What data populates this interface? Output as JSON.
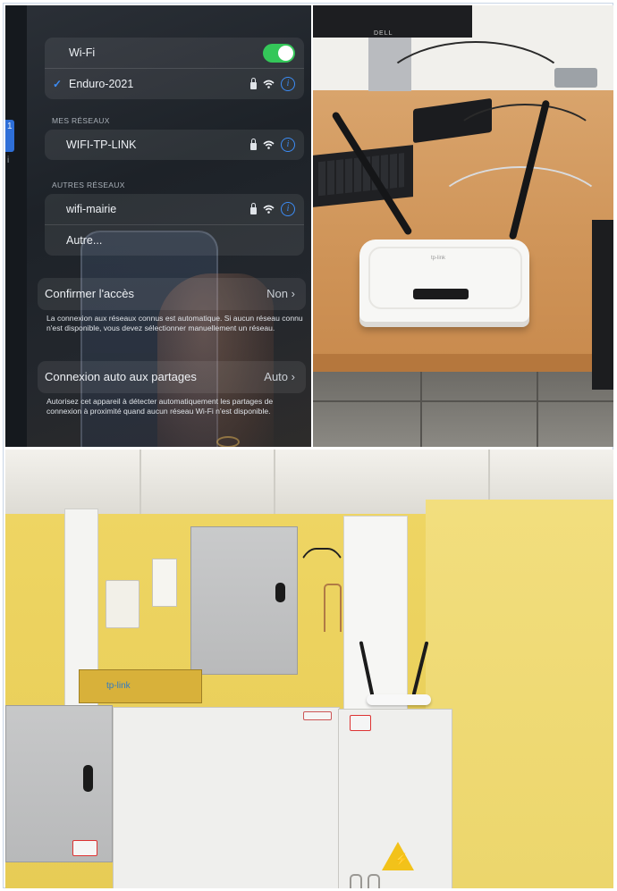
{
  "wifi_settings": {
    "wifi_label": "Wi-Fi",
    "wifi_enabled": true,
    "connected_network": "Enduro-2021",
    "my_networks_header": "MES RÉSEAUX",
    "my_networks": [
      "WIFI-TP-LINK"
    ],
    "other_networks_header": "AUTRES RÉSEAUX",
    "other_networks": [
      "wifi-mairie"
    ],
    "other_label": "Autre...",
    "ask_join": {
      "label": "Confirmer l'accès",
      "value": "Non",
      "help": "La connexion aux réseaux connus est automatique. Si aucun réseau connu n'est disponible, vous devez sélectionner manuellement un réseau."
    },
    "auto_hotspot": {
      "label": "Connexion auto aux partages",
      "value": "Auto",
      "help": "Autorisez cet appareil à détecter automatiquement les partages de connexion à proximité quand aucun réseau Wi-Fi n'est disponible."
    },
    "sidebar_mark": "1",
    "sidebar_mark2": "i"
  },
  "desk_photo": {
    "monitor_brand": "DELL",
    "router_brand": "tp-link"
  },
  "wall_photo": {
    "ap_brand": "tp-link",
    "warning_symbol": "⚡"
  },
  "icons": {
    "check": "✓",
    "chevron": "›",
    "info": "i"
  },
  "colors": {
    "toggle_on": "#34c759",
    "accent_blue": "#3c8cf5"
  }
}
